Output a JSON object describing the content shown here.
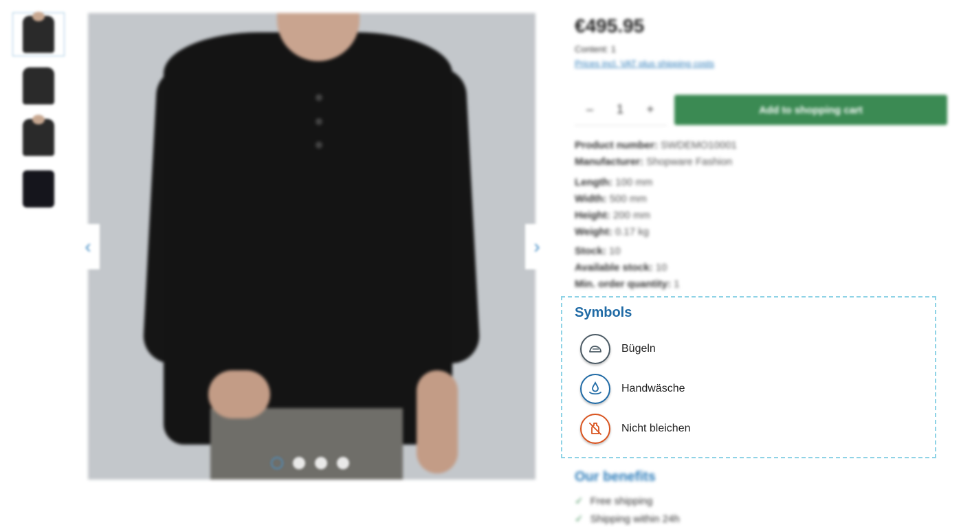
{
  "product": {
    "price": "€495.95",
    "content": "Content: 1",
    "vat_link": "Prices incl. VAT plus shipping costs"
  },
  "quantity": {
    "value": "1",
    "minus": "–",
    "plus": "+"
  },
  "cart": {
    "label": "Add to shopping cart",
    "color": "#3b8a53"
  },
  "properties": [
    {
      "label": "Product number:",
      "value": "SWDEMO10001"
    },
    {
      "label": "Manufacturer:",
      "value": "Shopware Fashion"
    },
    {
      "label": "Length:",
      "value": "100 mm"
    },
    {
      "label": "Width:",
      "value": "500 mm"
    },
    {
      "label": "Height:",
      "value": "200 mm"
    },
    {
      "label": "Weight:",
      "value": "0.17 kg"
    },
    {
      "label": "Stock:",
      "value": "10"
    },
    {
      "label": "Available stock:",
      "value": "10"
    },
    {
      "label": "Min. order quantity:",
      "value": "1"
    }
  ],
  "symbols": {
    "title": "Symbols",
    "items": [
      {
        "label": "Bügeln",
        "icon": "iron-icon",
        "color": "#4a5963"
      },
      {
        "label": "Handwäsche",
        "icon": "hand-wash-icon",
        "color": "#1f6aa5"
      },
      {
        "label": "Nicht bleichen",
        "icon": "no-bleach-icon",
        "color": "#d9531e"
      }
    ]
  },
  "benefits": {
    "title": "Our benefits",
    "items": [
      "Free shipping",
      "Shipping within 24h"
    ]
  },
  "gallery": {
    "prev": "‹",
    "next": "›",
    "slides": 4,
    "active": 1
  }
}
